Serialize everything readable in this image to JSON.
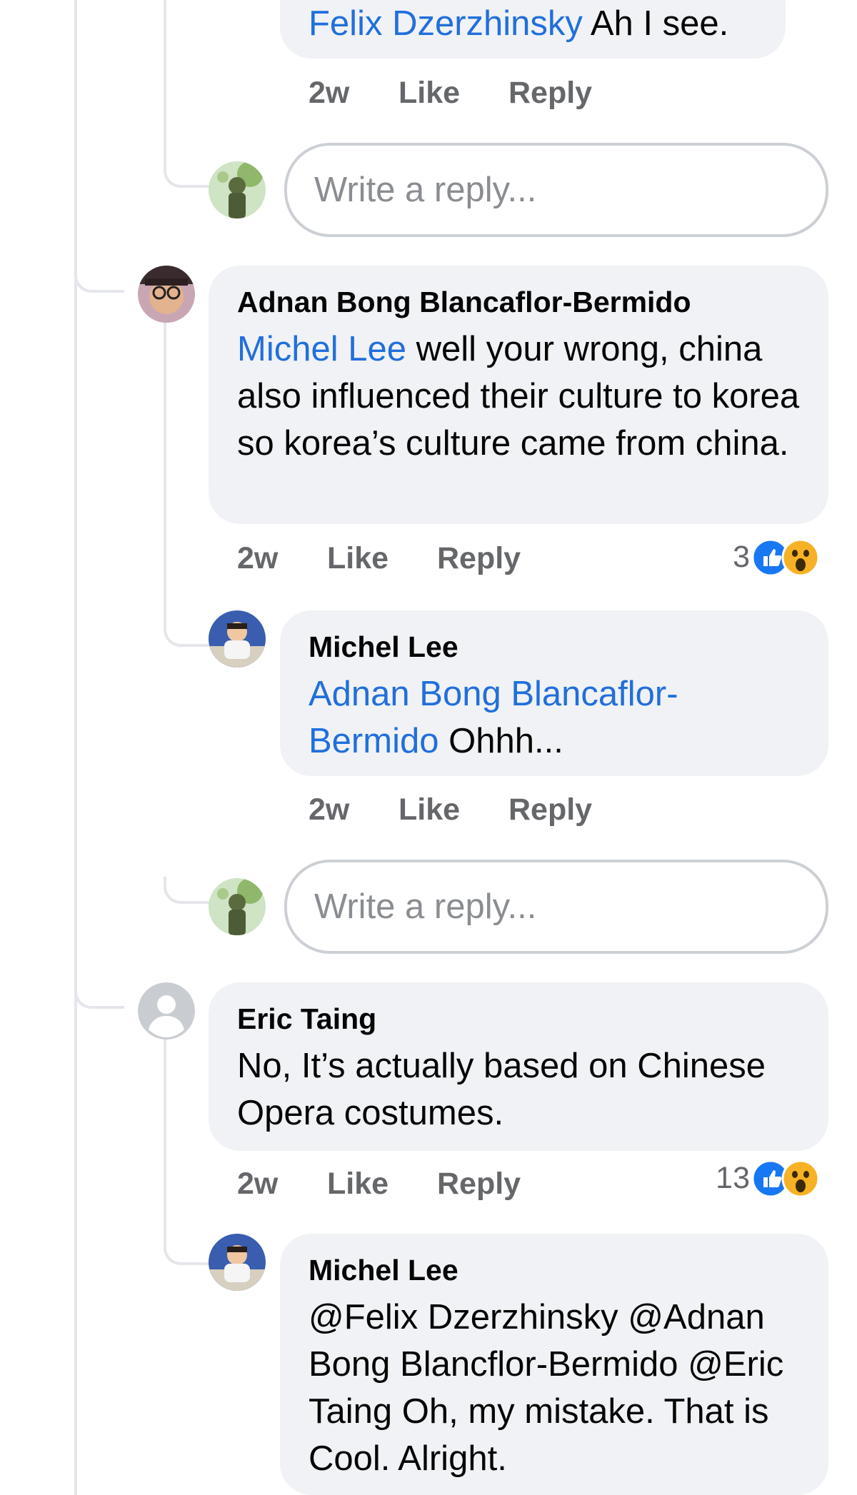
{
  "comments": [
    {
      "reply": {
        "mention": "Felix Dzerzhinsky",
        "text": "Ah I see.",
        "time": "2w",
        "like": "Like",
        "reply": "Reply"
      }
    },
    {
      "author": "Adnan Bong Blancaflor-Bermido",
      "mention": "Michel Lee",
      "text": "well your wrong, china also influenced their culture to korea so korea’s culture came from china.",
      "time": "2w",
      "like": "Like",
      "reply": "Reply",
      "reaction_count": "3",
      "reactions": [
        "like-icon",
        "wow-icon"
      ],
      "replies": [
        {
          "author": "Michel Lee",
          "mention": "Adnan Bong Blancaflor-Bermido",
          "text": "Ohhh...",
          "time": "2w",
          "like": "Like",
          "reply": "Reply"
        }
      ]
    },
    {
      "author": "Eric Taing",
      "text": "No, It’s actually based on Chinese Opera costumes.",
      "time": "2w",
      "like": "Like",
      "reply": "Reply",
      "reaction_count": "13",
      "reactions": [
        "like-icon",
        "wow-icon"
      ],
      "replies": [
        {
          "author": "Michel Lee",
          "text": "@Felix Dzerzhinsky @Adnan Bong Blancflor-Bermido @Eric Taing Oh, my mistake. That is Cool. Alright."
        }
      ]
    }
  ],
  "reply_placeholder": "Write a reply...",
  "colors": {
    "mention": "#216fdb",
    "bubble": "#f0f2f5",
    "meta": "#65676b",
    "like_blue": "#1877f2",
    "wow_yellow": "#f7b125"
  }
}
